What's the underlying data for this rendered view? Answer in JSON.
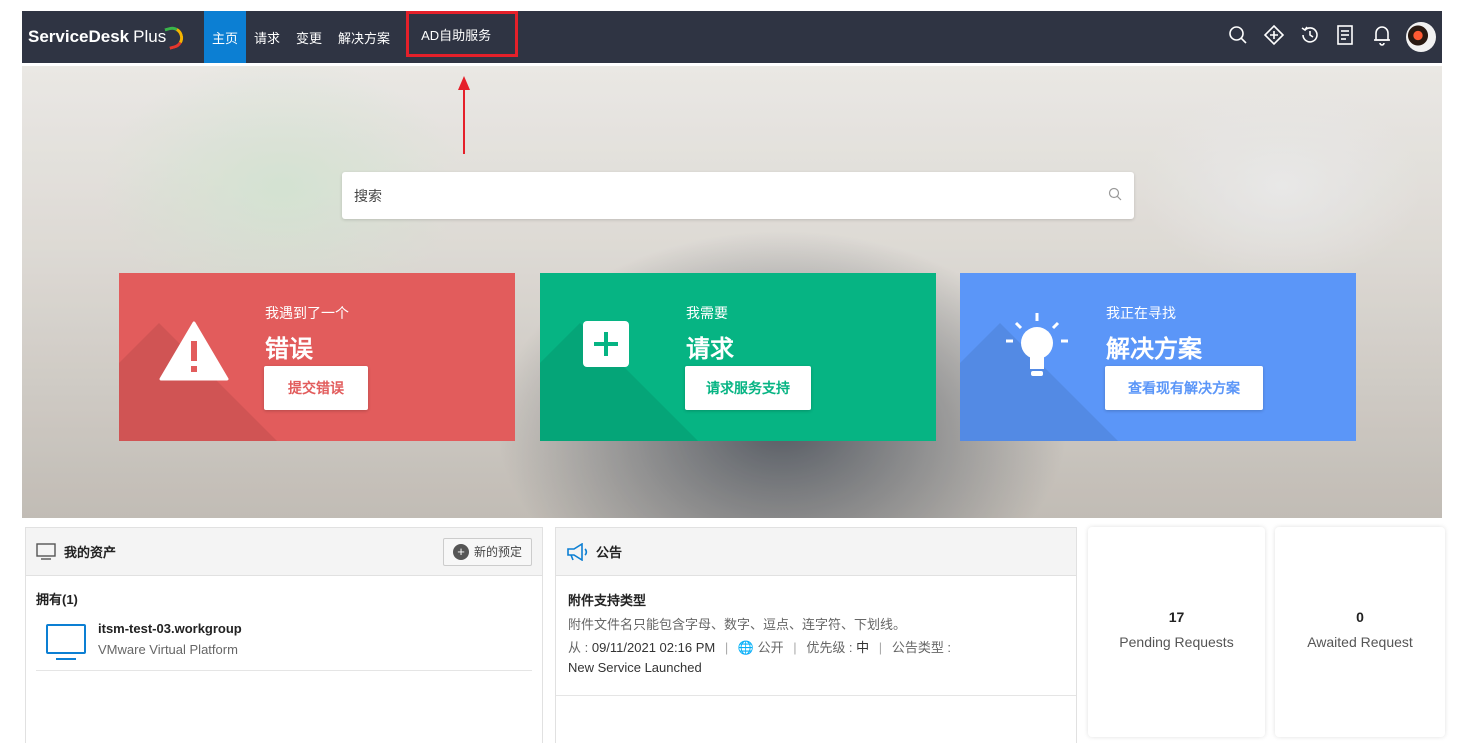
{
  "topbar": {
    "brand_main": "ServiceDesk",
    "brand_plus": "Plus",
    "nav": [
      "主页",
      "请求",
      "变更",
      "解决方案",
      "AD自助服务"
    ],
    "icons": [
      "search-icon",
      "quick-create-icon",
      "history-icon",
      "notes-icon",
      "bell-icon",
      "avatar"
    ]
  },
  "search": {
    "placeholder": "搜索"
  },
  "cards": {
    "issue": {
      "small": "我遇到了一个",
      "big": "错误",
      "button": "提交错误"
    },
    "request": {
      "small": "我需要",
      "big": "请求",
      "button": "请求服务支持"
    },
    "solution": {
      "small": "我正在寻找",
      "big": "解决方案",
      "button": "查看现有解决方案"
    }
  },
  "assets": {
    "title": "我的资产",
    "reserve_button": "新的预定",
    "own_label": "拥有(1)",
    "items": [
      {
        "name": "itsm-test-03.workgroup",
        "platform": "VMware Virtual Platform"
      }
    ]
  },
  "notices": {
    "title": "公告",
    "items": [
      {
        "title": "附件支持类型",
        "description": "附件文件名只能包含字母、数字、逗点、连字符、下划线。",
        "from_label": "从 : ",
        "from_date": "09/11/2021 02:16 PM",
        "visibility": "公开",
        "priority_label": "优先级 : ",
        "priority": "中",
        "type_label": "公告类型 :",
        "type": "New Service Launched"
      }
    ]
  },
  "stats": [
    {
      "value": "17",
      "label": "Pending Requests"
    },
    {
      "value": "0",
      "label": "Awaited Request"
    }
  ],
  "colors": {
    "topbar": "#2f3443",
    "active_nav": "#0c7fd3",
    "highlight": "#e5202a",
    "card_red": "#e25c5c",
    "card_green": "#06b483",
    "card_blue": "#5b96f8"
  }
}
